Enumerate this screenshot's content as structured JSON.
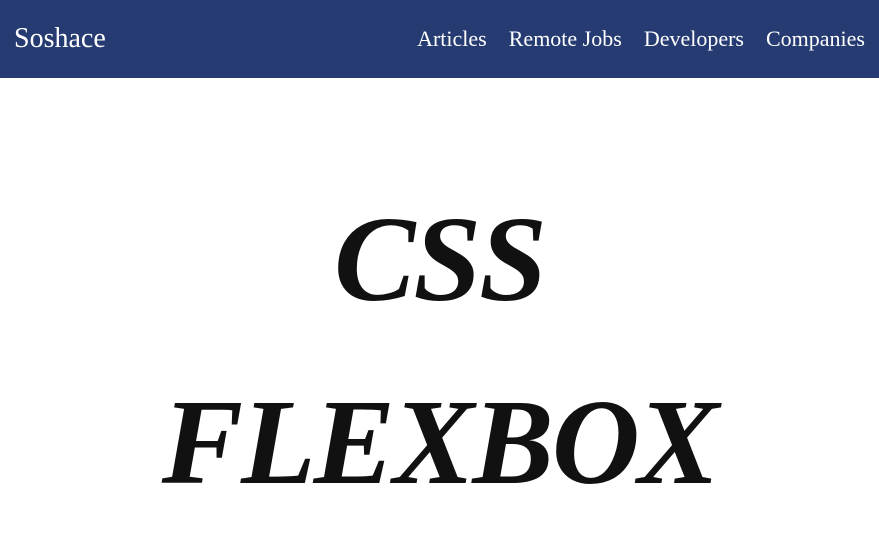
{
  "header": {
    "logo": "Soshace",
    "nav": {
      "articles": "Articles",
      "remote_jobs": "Remote Jobs",
      "developers": "Developers",
      "companies": "Companies"
    }
  },
  "content": {
    "title_line1": "CSS",
    "title_line2": "FLEXBOX"
  }
}
